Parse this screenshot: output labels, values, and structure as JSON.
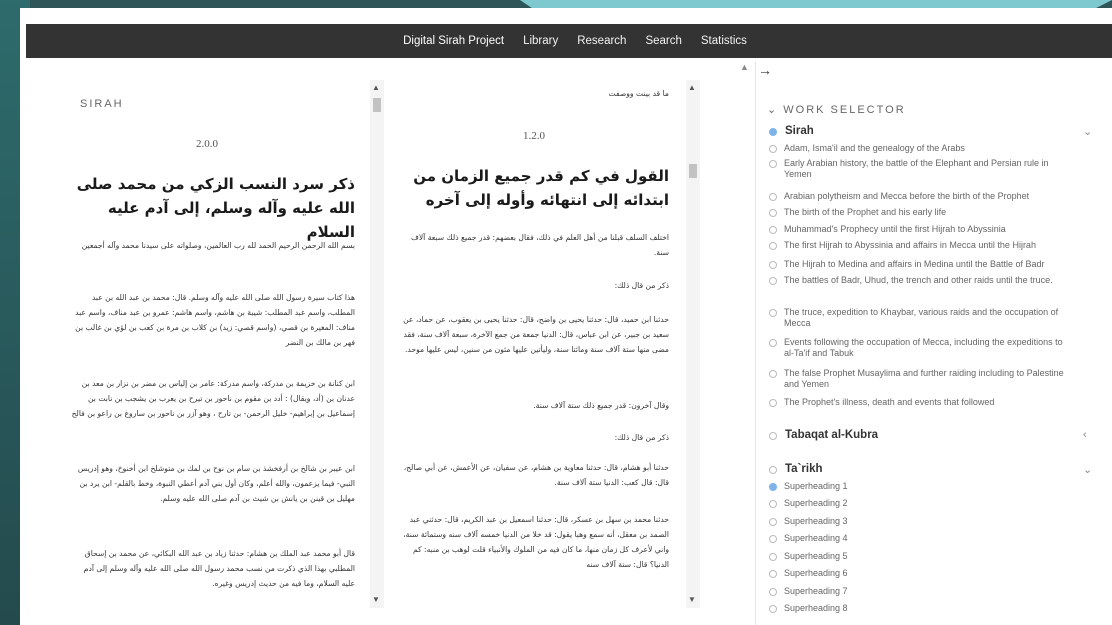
{
  "nav": {
    "brand": "Digital Sirah Project",
    "links": [
      "Library",
      "Research",
      "Search",
      "Statistics"
    ]
  },
  "left_text": {
    "label": "SIRAH",
    "version": "2.0.0",
    "heading": "ذكر سرد النسب الزكي من محمد صلى الله عليه وآله وسلم، إلى آدم عليه السلام",
    "paragraphs": [
      "بسم الله الرحمن الرحيم الحمد لله رب العالمين، وصلواته على سيدنا محمد وآله أجمعين",
      "هذا كتاب سيرة رسول الله صلى الله عليه وآله وسلم. قال: محمد بن عبد الله بن عبد المطلب، واسم عبد المطلب: شيبة بن هاشم، واسم هاشم: عمرو بن عبد مناف، واسم عبد مناف: المغيرة بن قصي، (واسم قصي: زيد) بن كلاب بن مرة بن كعب بن لؤي بن غالب بن فهر بن مالك بن النضر",
      "ابن كنانة بن خزيمة بن مدركة، واسم مدركة: عامر بن إلياس بن مضر بن نزار بن معد بن عدنان بن (أد، ويقال) : أدد بن مقوم بن ناحور بن تيرح بن يعرب بن يشجب بن نابت بن إسماعيل بن إبراهيم- خليل الرحمن- بن تارح ، وهو آزر بن ناحور بن ساروغ بن راعو بن فالخ",
      "ابن عيبر بن شالخ بن أرفخشذ بن سام بن نوح بن لمك بن متوشلخ ابن أخنوخ، وهو إدريس النبي- فيما يزعمون، والله أعلم، وكان أول بني آدم أعطي النبوة، وخط بالقلم- ابن يرد بن مهليل بن قينن بن يانش بن شيث بن آدم صلى الله عليه وسلم.",
      "قال أبو محمد عبد الملك بن هشام: حدثنا زياد بن عبد الله البكائي، عن محمد بن إسحاق المطلبي بهذا الذي ذكرت من نسب محمد رسول الله صلى الله عليه وآله وسلم إلى آدم عليه السلام، وما فيه من حديث إدريس وغيره."
    ]
  },
  "right_text": {
    "top_fragment": "ما قد بينت ووصفت",
    "version": "1.2.0",
    "heading": "القول في كم قدر جميع الزمان من ابتدائه إلى انتهائه وأوله إلى آخره",
    "paragraphs": [
      "اختلف السلف قبلنا من أهل العلم في ذلك، فقال بعضهم: قدر جميع ذلك سبعة آلاف سنة.",
      "ذكر من قال ذلك:",
      "حدثنا ابن حميد، قال: حدثنا يحيى بن واضح، قال: حدثنا يحيى بن يعقوب، عن حماد، عن سعيد بن جبير، عن ابن عباس، قال: الدنيا جمعة من جمع الآخرة، سبعة آلاف سنة، فقد مضى منها ستة آلاف سنة ومائتا سنة، وليأتين عليها مئون من سنين، ليس عليها موحد.",
      "وقال آخرون: قدر جميع ذلك ستة آلاف سنة.",
      "ذكر من قال ذلك:",
      "حدثنا أبو هشام، قال: حدثنا معاوية بن هشام، عن سفيان، عن الأعمش، عن أبي صالح، قال: قال كعب: الدنيا ستة آلاف سنة.",
      "حدثنا محمد بن سهل بن عسكر، قال: حدثنا اسمعيل بن عبد الكريم، قال: حدثني عبد الصمد بن معقل، أنه سمع وهبا يقول: قد خلا من الدنيا خمسه آلاف سنه وستمائة سنة، واني لأعرف كل زمان منها، ما كان فيه من الملوك والأنبياء قلت لوهب بن منبه: كم الدنيا؟ قال: ستة آلاف سنه"
    ]
  },
  "selector": {
    "title": "WORK SELECTOR",
    "books": [
      {
        "title": "Sirah",
        "chevron": "chevron-down",
        "items": [
          "Adam, Isma'il and the genealogy of the Arabs",
          "Early Arabian history, the battle of the Elephant and Persian rule in Yemen",
          "Arabian polytheism and Mecca before the birth of the Prophet",
          "The birth of the Prophet and his early life",
          "Muhammad's Prophecy until the first Hijrah to Abyssinia",
          "The first Hijrah to Abyssinia and affairs in Mecca until the Hijrah",
          "The Hijrah to Medina and affairs in Medina until the Battle of Badr",
          "The battles of Badr, Uhud, the trench and other raids until the truce.",
          "The truce, expedition to Khaybar, various raids and the occupation of Mecca",
          "Events following the occupation of Mecca, including the expeditions to al-Ta'if and Tabuk",
          "The false Prophet Musaylima and further raiding including to Palestine and Yemen",
          "The Prophet's illness, death and events that followed"
        ]
      },
      {
        "title": "Tabaqat al-Kubra",
        "chevron": "chevron-left",
        "items": []
      },
      {
        "title": "Ta`rikh",
        "chevron": "chevron-down",
        "items": [
          "Superheading 1",
          "Superheading 2",
          "Superheading 3",
          "Superheading 4",
          "Superheading 5",
          "Superheading 6",
          "Superheading 7",
          "Superheading 8"
        ]
      }
    ]
  },
  "colors": {
    "navbar": "#333333",
    "accent_radio": "#7fb4ea",
    "background": "#2f5558"
  }
}
